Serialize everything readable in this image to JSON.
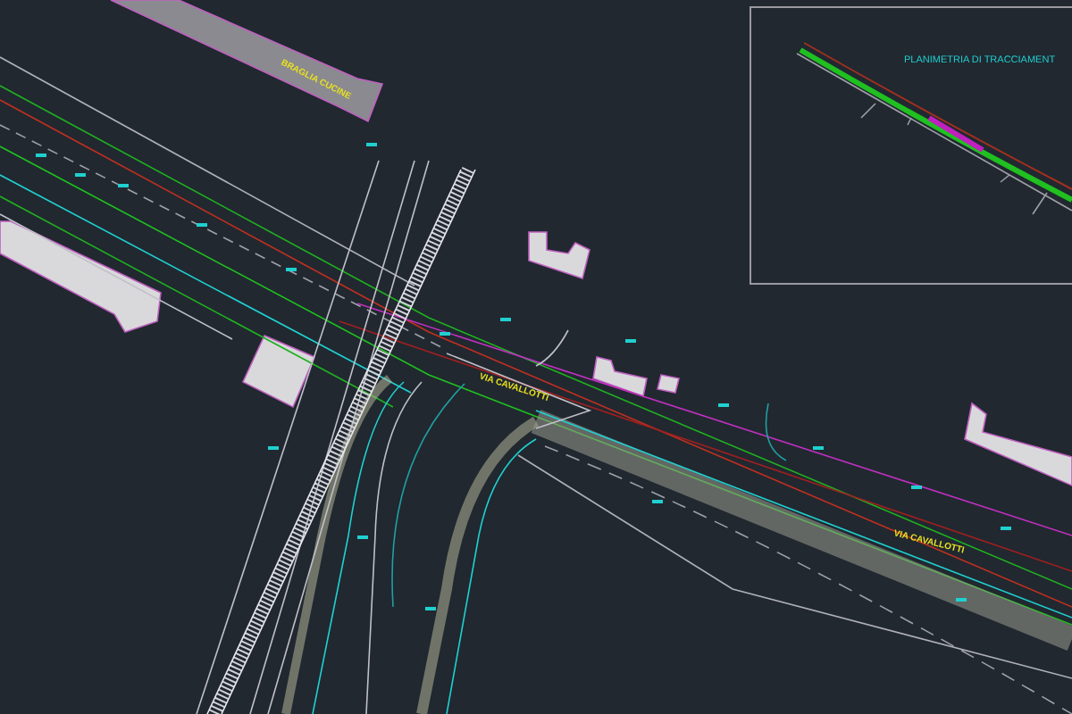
{
  "drawing": {
    "building_label": "BRAGLIA CUCINE",
    "street_labels": [
      "VIA CAVALLOTTI",
      "VIA CAVALLOTTI"
    ],
    "inset": {
      "title": "PLANIMETRIA DI TRACCIAMENT"
    }
  }
}
